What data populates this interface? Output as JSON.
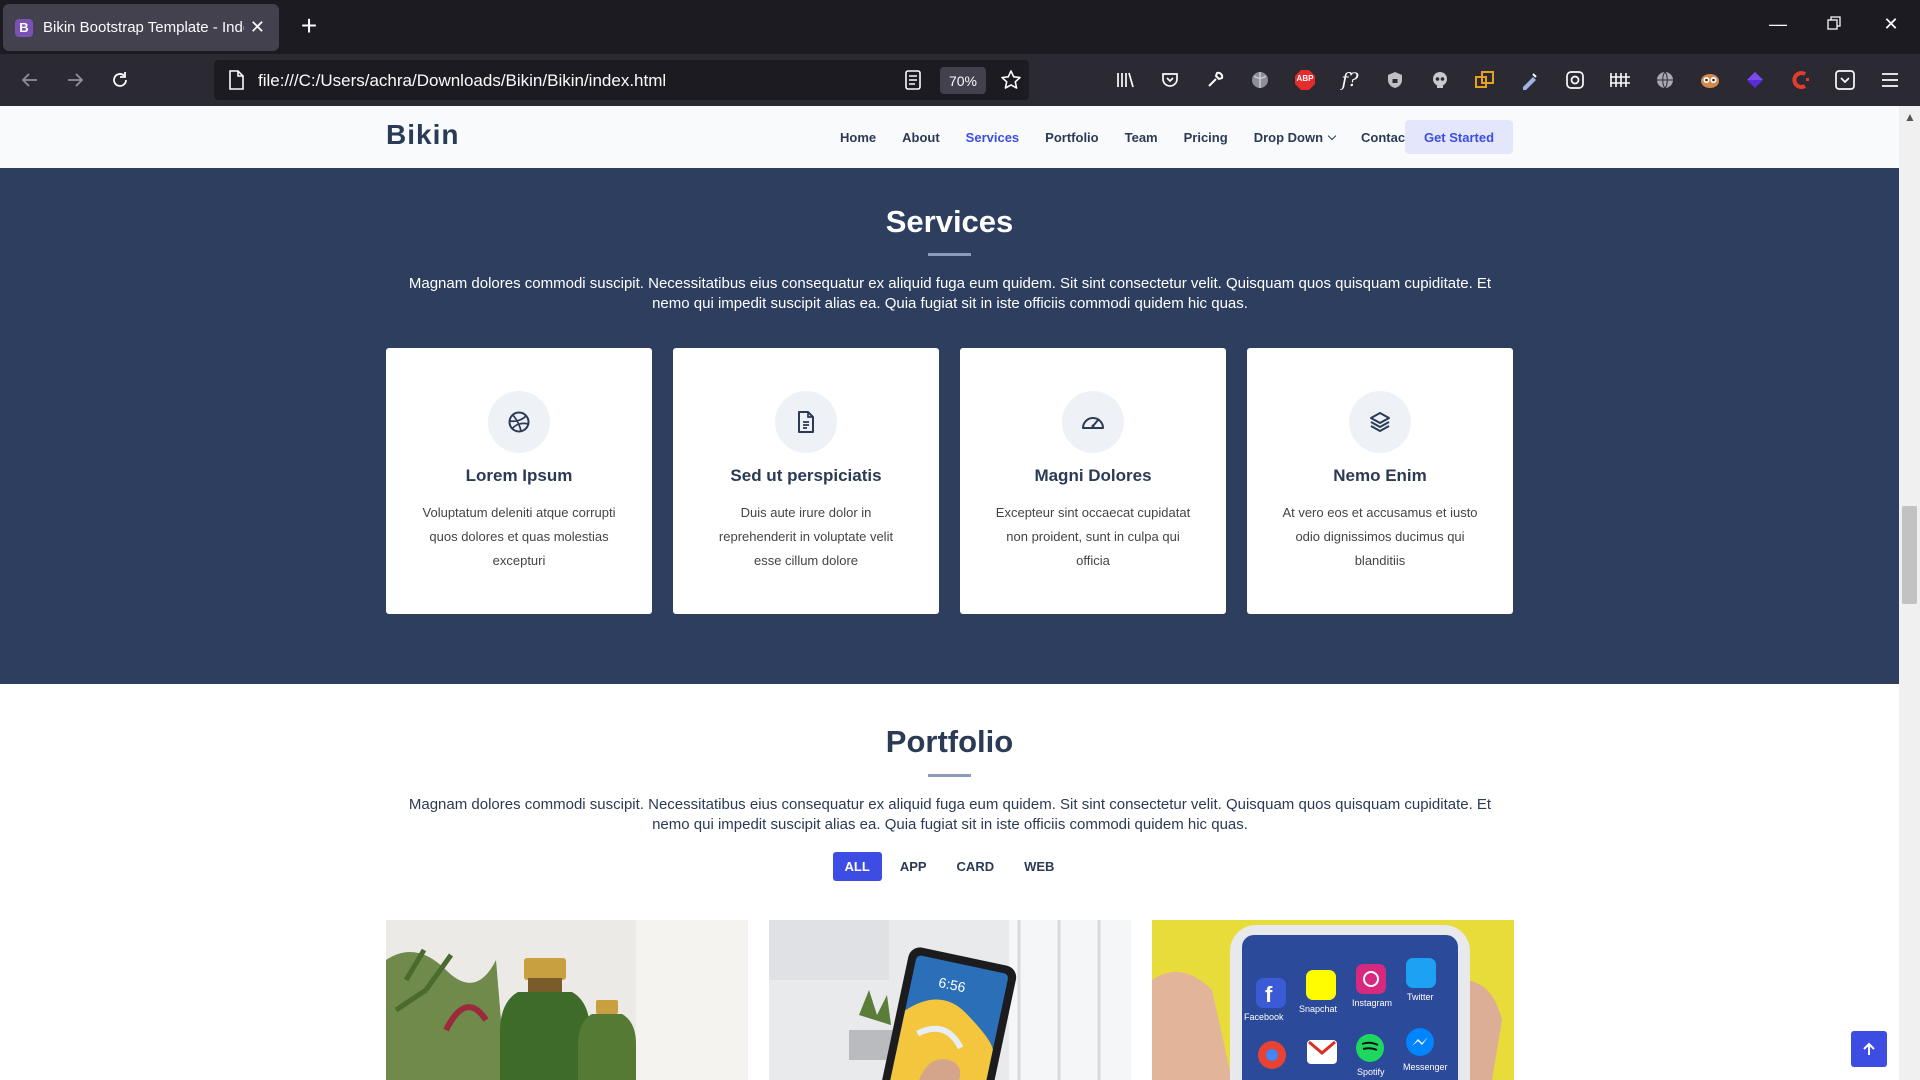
{
  "browser": {
    "tab_title": "Bikin Bootstrap Template - Index",
    "tab_favicon_letter": "B",
    "url": "file:///C:/Users/achra/Downloads/Bikin/Bikin/index.html",
    "zoom": "70%",
    "abp_label": "ABP",
    "fx_label": "f?"
  },
  "site": {
    "logo": "Bikin",
    "nav": {
      "home": "Home",
      "about": "About",
      "services": "Services",
      "portfolio": "Portfolio",
      "team": "Team",
      "pricing": "Pricing",
      "dropdown": "Drop Down",
      "contact": "Contact"
    },
    "cta": "Get Started"
  },
  "services": {
    "title": "Services",
    "description": "Magnam dolores commodi suscipit. Necessitatibus eius consequatur ex aliquid fuga eum quidem. Sit sint consectetur velit. Quisquam quos quisquam cupiditate. Et nemo qui impedit suscipit alias ea. Quia fugiat sit in iste officiis commodi quidem hic quas.",
    "cards": [
      {
        "icon": "dribbble-icon",
        "title": "Lorem Ipsum",
        "text": "Voluptatum deleniti atque corrupti quos dolores et quas molestias excepturi"
      },
      {
        "icon": "document-icon",
        "title": "Sed ut perspiciatis",
        "text": "Duis aute irure dolor in reprehenderit in voluptate velit esse cillum dolore"
      },
      {
        "icon": "speedometer-icon",
        "title": "Magni Dolores",
        "text": "Excepteur sint occaecat cupidatat non proident, sunt in culpa qui officia"
      },
      {
        "icon": "layers-icon",
        "title": "Nemo Enim",
        "text": "At vero eos et accusamus et iusto odio dignissimos ducimus qui blanditiis"
      }
    ]
  },
  "portfolio": {
    "title": "Portfolio",
    "description": "Magnam dolores commodi suscipit. Necessitatibus eius consequatur ex aliquid fuga eum quidem. Sit sint consectetur velit. Quisquam quos quisquam cupiditate. Et nemo qui impedit suscipit alias ea. Quia fugiat sit in iste officiis commodi quidem hic quas.",
    "filters": [
      "ALL",
      "APP",
      "CARD",
      "WEB"
    ],
    "active_filter": "ALL",
    "items": [
      {
        "image": "green-bottles-photo"
      },
      {
        "image": "tablet-on-desk-photo",
        "screen_time": "6:56"
      },
      {
        "image": "phone-social-apps-photo",
        "apps": [
          "Facebook",
          "Snapchat",
          "Instagram",
          "Twitter",
          "Spotify",
          "Messenger"
        ]
      }
    ]
  },
  "colors": {
    "accent": "#3d4de4",
    "navy": "#2d3e5f",
    "heading": "#2b3a55",
    "rule": "#8a9bbd"
  }
}
